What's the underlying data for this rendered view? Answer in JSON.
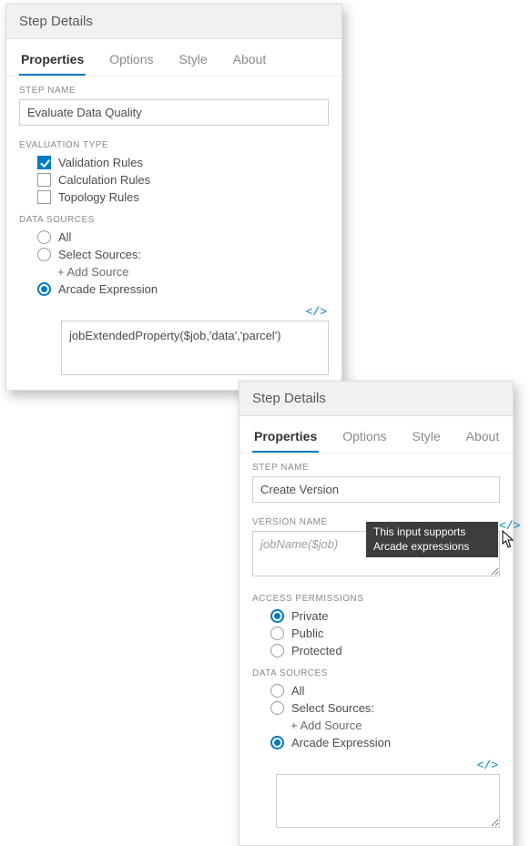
{
  "panel1": {
    "title": "Step Details",
    "tabs": [
      "Properties",
      "Options",
      "Style",
      "About"
    ],
    "step_name_label": "STEP NAME",
    "step_name_value": "Evaluate Data Quality",
    "eval_type_label": "EVALUATION TYPE",
    "eval_types": [
      {
        "label": "Validation Rules",
        "checked": true
      },
      {
        "label": "Calculation Rules",
        "checked": false
      },
      {
        "label": "Topology Rules",
        "checked": false
      }
    ],
    "data_sources_label": "DATA SOURCES",
    "ds_options": [
      {
        "label": "All",
        "checked": false
      },
      {
        "label": "Select Sources:",
        "checked": false
      },
      {
        "label": "Arcade Expression",
        "checked": true
      }
    ],
    "add_source_label": "+ Add Source",
    "arcade_code": "jobExtendedProperty($job,'data','parcel')"
  },
  "panel2": {
    "title": "Step Details",
    "tabs": [
      "Properties",
      "Options",
      "Style",
      "About"
    ],
    "step_name_label": "STEP NAME",
    "step_name_value": "Create Version",
    "version_name_label": "VERSION NAME",
    "version_name_placeholder": "jobName($job)",
    "tooltip_text": "This input supports Arcade expressions",
    "access_label": "ACCESS PERMISSIONS",
    "access_options": [
      {
        "label": "Private",
        "checked": true
      },
      {
        "label": "Public",
        "checked": false
      },
      {
        "label": "Protected",
        "checked": false
      }
    ],
    "data_sources_label": "DATA SOURCES",
    "ds_options": [
      {
        "label": "All",
        "checked": false
      },
      {
        "label": "Select Sources:",
        "checked": false
      },
      {
        "label": "Arcade Expression",
        "checked": true
      }
    ],
    "add_source_label": "+ Add Source",
    "arcade_code": ""
  },
  "icons": {
    "code_glyph": "</>"
  }
}
